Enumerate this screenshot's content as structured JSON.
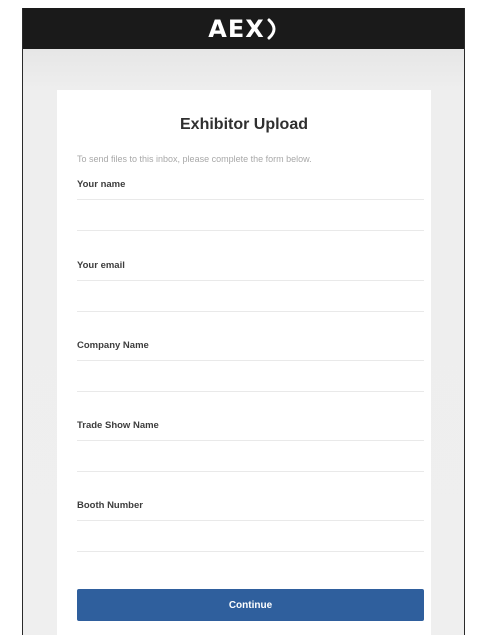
{
  "header": {
    "logo_text": "AEX"
  },
  "form": {
    "title": "Exhibitor Upload",
    "intro": "To send files to this inbox, please complete the form below.",
    "fields": [
      {
        "label": "Your name",
        "value": ""
      },
      {
        "label": "Your email",
        "value": ""
      },
      {
        "label": "Company Name",
        "value": ""
      },
      {
        "label": "Trade Show Name",
        "value": ""
      },
      {
        "label": "Booth Number",
        "value": ""
      }
    ],
    "submit_label": "Continue"
  },
  "colors": {
    "header_bg": "#1a1a1a",
    "button_bg": "#2f5f9d",
    "page_bg": "#ececec"
  }
}
